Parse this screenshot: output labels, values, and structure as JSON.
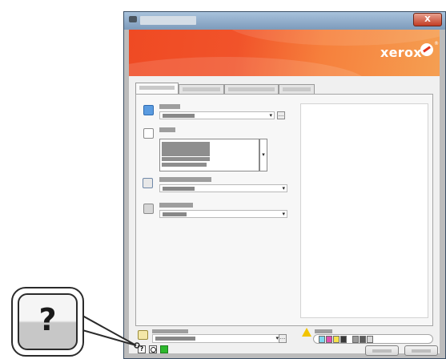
{
  "window": {
    "close_label": "X"
  },
  "banner": {
    "brand_word": "xerox",
    "brand_mark": "xerox-sphere-logo",
    "registered_mark": "®",
    "colors": {
      "start": "#ef4a23",
      "end": "#f59f52"
    }
  },
  "callout": {
    "symbol": "?",
    "points_to": "help-button"
  },
  "controls": {
    "dropdown_arrow": "▾",
    "more_button": "...",
    "spin_arrow": "▾"
  },
  "bottom_bar": {
    "warning_icon": "warning-triangle-icon",
    "help_icon": "question-icon",
    "reset_icon": "reset-icon",
    "status_icon": "green-status-icon"
  },
  "colors": {
    "accent_orange": "#ef4a23",
    "ok_green": "#2db82d",
    "warning_yellow": "#f2c400"
  }
}
